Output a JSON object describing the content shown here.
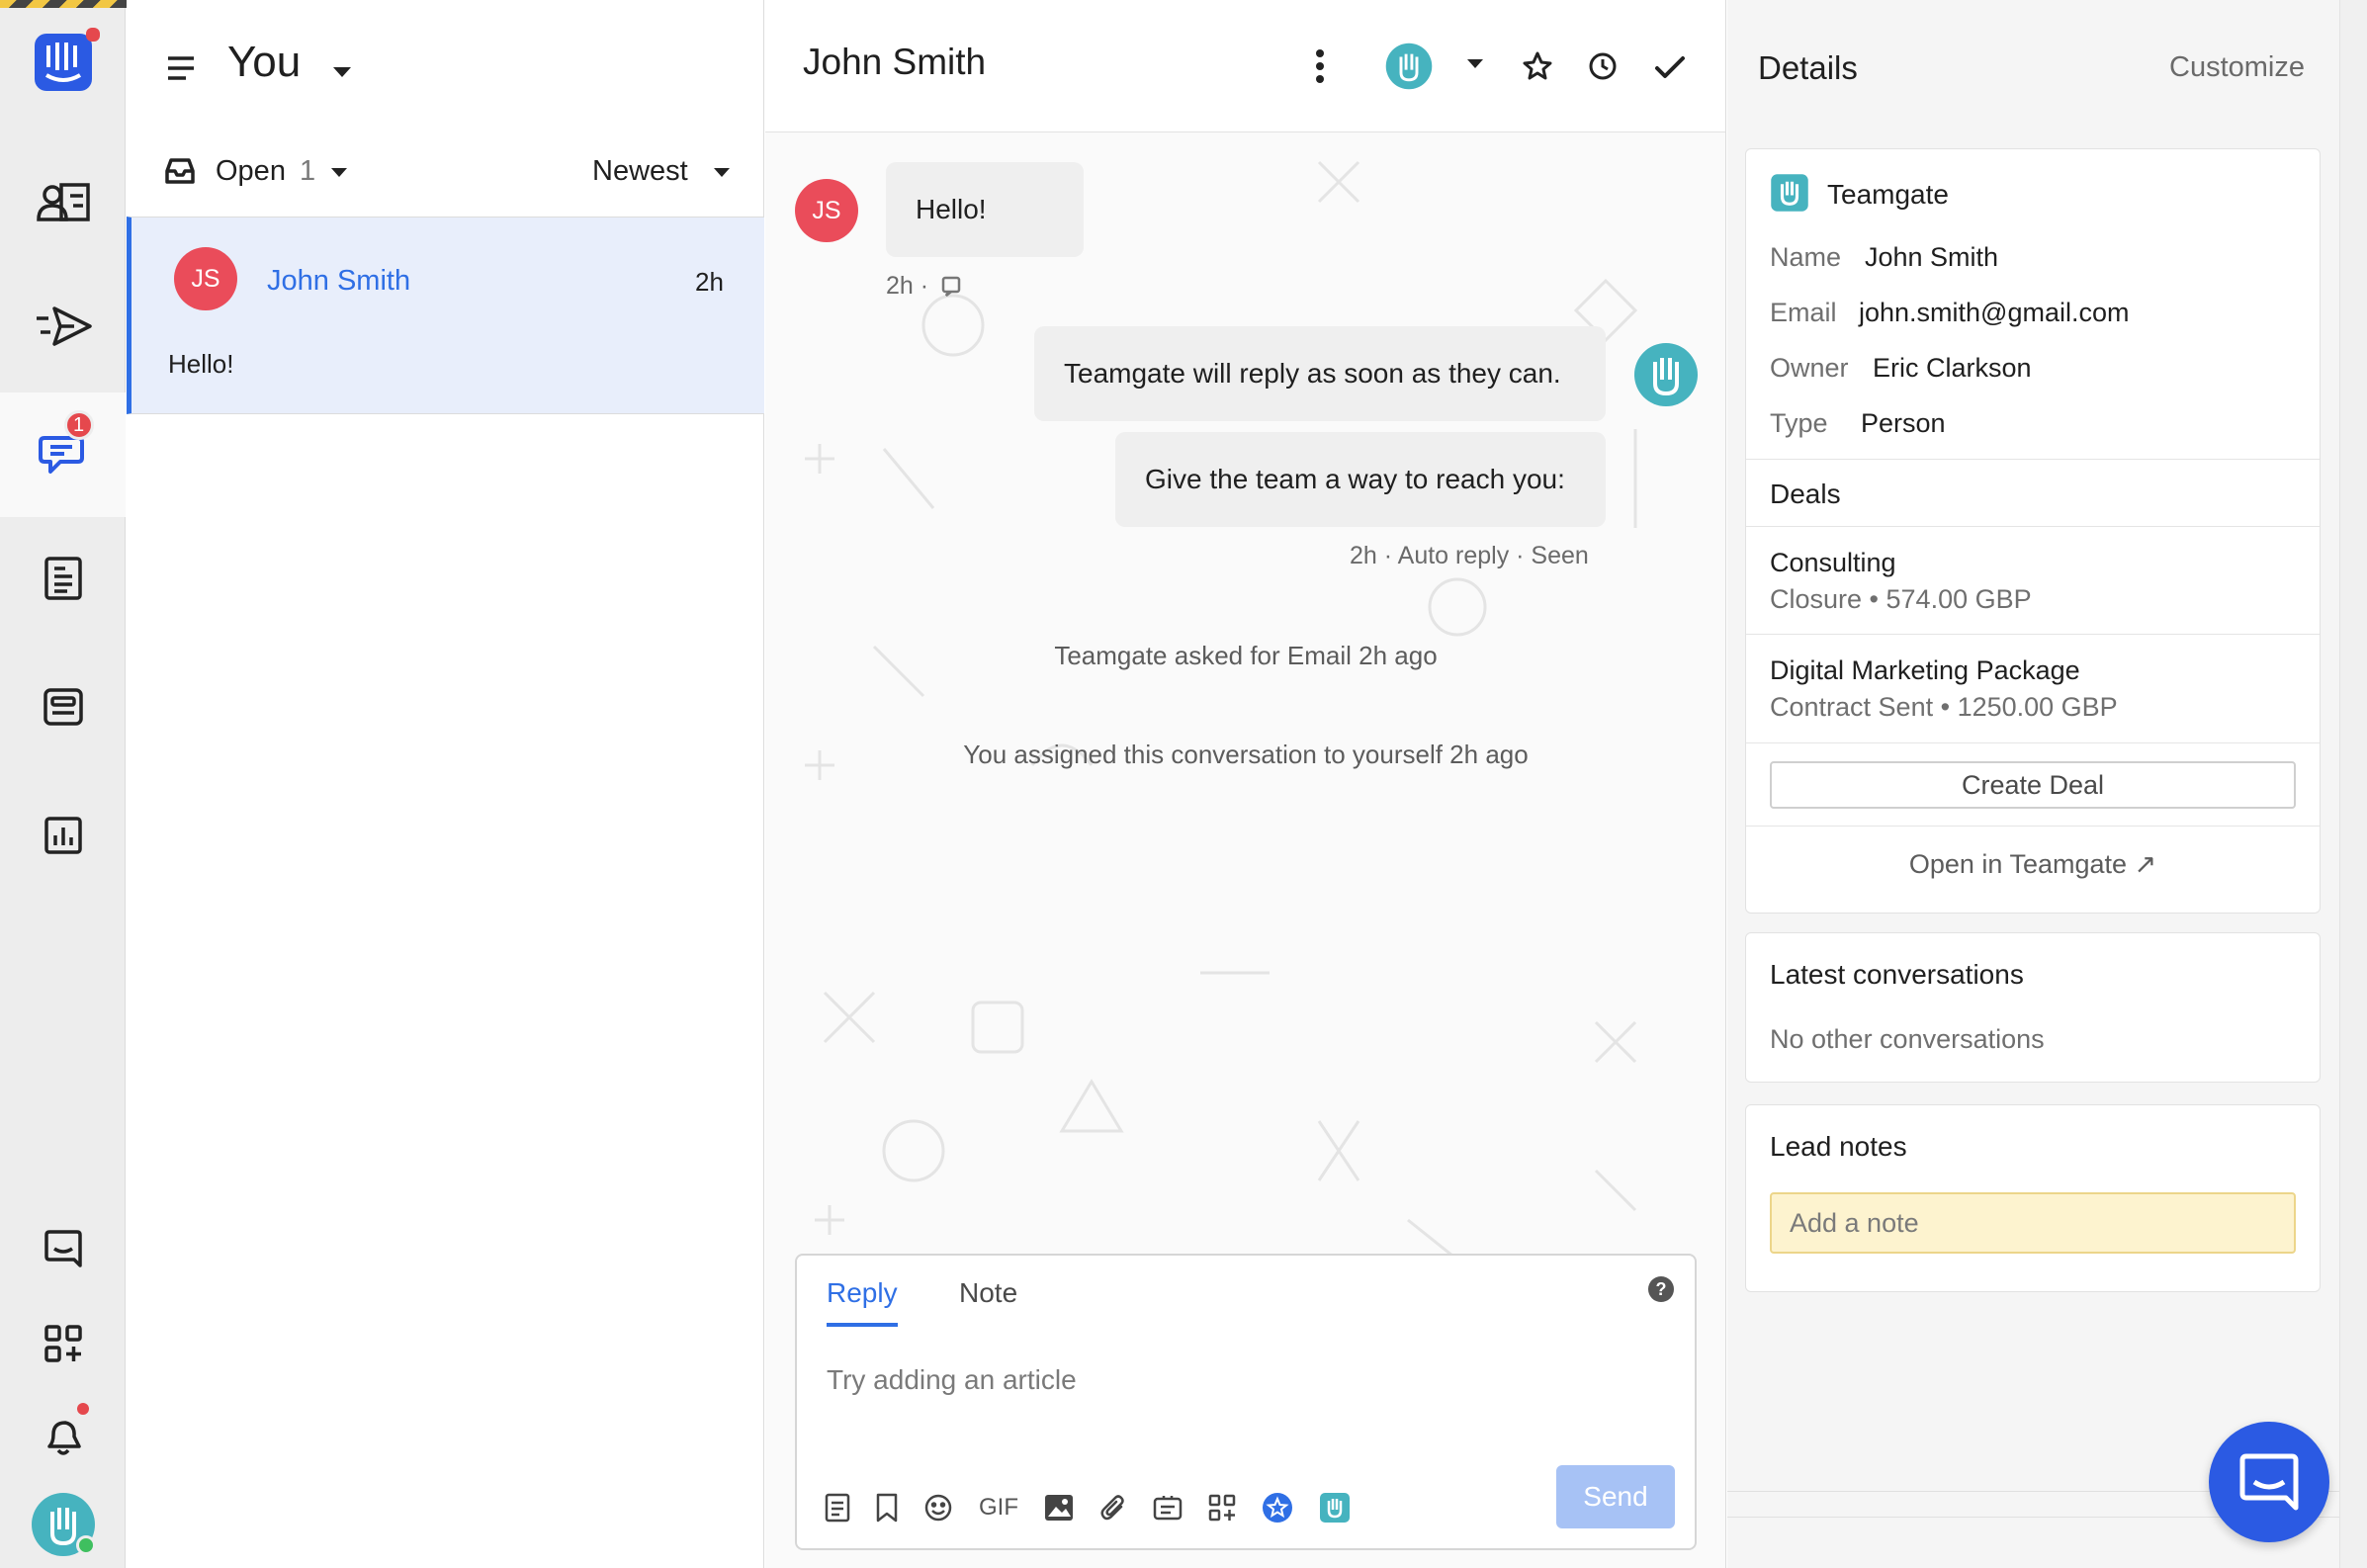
{
  "nav": {
    "conversations_badge": "1"
  },
  "inbox": {
    "title": "You",
    "filter_label": "Open",
    "filter_count": "1",
    "sort_label": "Newest",
    "items": [
      {
        "initials": "JS",
        "name": "John Smith",
        "time": "2h",
        "preview": "Hello!"
      }
    ]
  },
  "conversation": {
    "title": "John Smith",
    "user_initials": "JS",
    "messages": {
      "hello_text": "Hello!",
      "hello_meta": "2h ·",
      "bot_reply_1": "Teamgate will reply as soon as they can.",
      "bot_reply_2": "Give the team a way to reach you:",
      "bot_meta": "2h · Auto reply · Seen"
    },
    "events": [
      "Teamgate asked for Email 2h ago",
      "You assigned this conversation to yourself 2h ago"
    ]
  },
  "composer": {
    "tab_reply": "Reply",
    "tab_note": "Note",
    "placeholder": "Try adding an article",
    "gif_label": "GIF",
    "send_label": "Send"
  },
  "details": {
    "title": "Details",
    "customize_label": "Customize",
    "app_name": "Teamgate",
    "fields": [
      {
        "key": "Name",
        "value": "John Smith"
      },
      {
        "key": "Email",
        "value": "john.smith@gmail.com"
      },
      {
        "key": "Owner",
        "value": "Eric Clarkson"
      },
      {
        "key": "Type",
        "value": "Person"
      }
    ],
    "deals_heading": "Deals",
    "deals": [
      {
        "name": "Consulting",
        "stage": "Closure",
        "amount": "574.00 GBP"
      },
      {
        "name": "Digital Marketing Package",
        "stage": "Contract Sent",
        "amount": "1250.00 GBP"
      }
    ],
    "create_deal_label": "Create Deal",
    "open_in_label": "Open in Teamgate ↗",
    "latest_heading": "Latest conversations",
    "latest_empty": "No other conversations",
    "lead_notes_heading": "Lead notes",
    "lead_notes_placeholder": "Add a note"
  },
  "colors": {
    "accent": "#2f6fe5",
    "avatar_red": "#ea4c5a",
    "teamgate_teal": "#46b3bf",
    "launcher_blue": "#2b5ae3"
  },
  "icons": [
    "intercom-logo-icon",
    "contacts-icon",
    "outbound-icon",
    "inbox-icon",
    "articles-icon",
    "inbox-stack-icon",
    "reports-icon",
    "messenger-icon",
    "apps-icon",
    "notifications-icon",
    "hamburger-icon",
    "inbox-tray-icon",
    "more-vertical-icon",
    "star-icon",
    "snooze-icon",
    "check-icon",
    "help-icon",
    "launcher-icon"
  ]
}
